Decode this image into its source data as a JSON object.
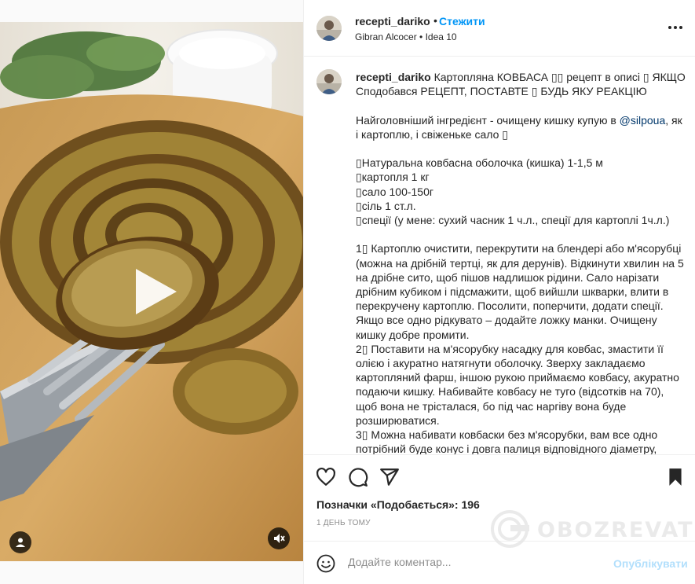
{
  "post": {
    "username": "recepti_dariko",
    "follow_label": "Стежити",
    "dot": "•",
    "subtitle": "Gibran Alcocer • Idea 10"
  },
  "caption": {
    "username": "recepti_dariko",
    "line1": " Картопляна КОВБАСА ▯▯ рецепт в описі ▯ ЯКЩО Сподобався РЕЦЕПТ, ПОСТАВТЕ ▯ БУДЬ ЯКУ РЕАКЦІЮ",
    "p2_pre": "Найголовніший інгредієнт - очищену кишку купую в ",
    "p2_tag": "@silpoua",
    "p2_post": ", як і картоплю, і свіженьке сало ▯",
    "ingredients": [
      "▯Натуральна ковбасна оболочка (кишка) 1-1,5 м",
      "▯картопля 1 кг",
      "▯сало 100-150г",
      "▯сіль 1 ст.л.",
      "▯спеції (у мене: сухий часник 1 ч.л., спеції для картоплі 1ч.л.)"
    ],
    "step1": "1▯ Картоплю очистити, перекрутити на блендері або м'ясорубці (можна на дрібній тертці, як для дерунів). Відкинути хвилин на 5 на дрібне сито, щоб пішов надлишок рідини. Сало нарізати дрібним кубиком і підсмажити, щоб вийшли шкварки, влити в перекручену картоплю. Посолити, поперчити, додати спеції. Якщо все одно рідкувато – додайте ложку манки. Очищену кишку добре промити.",
    "step2": "2▯ Поставити на м'ясорубку насадку для ковбас, змастити її олією і акуратно натягнути оболочку. Зверху закладаємо картопляний фарш, іншою рукою приймаємо ковбасу, акуратно подаючи кишку. Набивайте ковбасу не туго (відсотків на 70), щоб вона не трісталася, бо під час наргіву вона буде розширюватися.",
    "step3": "3▯ Можна набивати ковбаски без м'ясорубки, вам все одно потрібний буде конус і довга палиця відповідного діаметру,"
  },
  "actions": {
    "likes": "Позначки «Подобається»: 196",
    "time": "1 ДЕНЬ ТОМУ"
  },
  "comment": {
    "placeholder": "Додайте коментар...",
    "post_label": "Опублікувати"
  },
  "watermark": {
    "text": "OBOZREVATEL"
  },
  "colors": {
    "accent": "#0095f6",
    "post_disabled": "#b2dffc",
    "text": "#262626",
    "muted": "#8e8e8e"
  }
}
